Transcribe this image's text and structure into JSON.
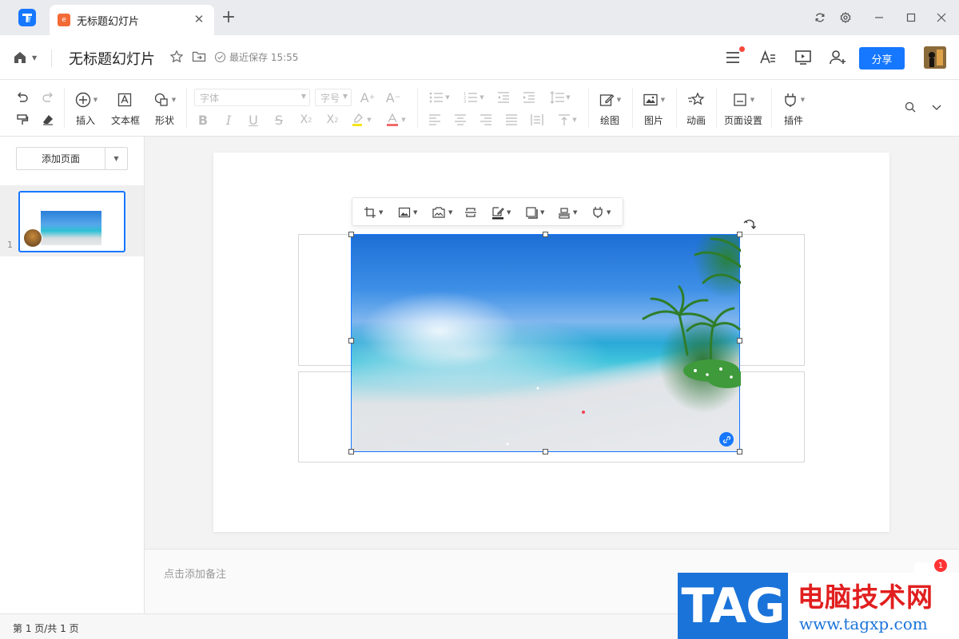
{
  "tab": {
    "title": "无标题幻灯片",
    "favicon": "e"
  },
  "header": {
    "doc_title": "无标题幻灯片",
    "save_status": "最近保存 15:55",
    "share_label": "分享"
  },
  "ribbon": {
    "insert": "插入",
    "textbox": "文本框",
    "shape": "形状",
    "font_placeholder": "字体",
    "size_placeholder": "字号",
    "draw": "绘图",
    "picture": "图片",
    "animation": "动画",
    "page_setup": "页面设置",
    "plugin": "插件"
  },
  "left_panel": {
    "add_page": "添加页面",
    "thumb_number": "1"
  },
  "notes": {
    "placeholder": "点击添加备注"
  },
  "status": {
    "page_count": "第 1 页/共 1 页"
  },
  "notification": {
    "count": "1"
  },
  "watermark": {
    "tag": "TAG",
    "title": "电脑技术网",
    "url": "www.tagxp.com"
  },
  "colors": {
    "accent": "#1677ff",
    "tab_favicon": "#f26a35",
    "badge": "#f5483b",
    "watermark_blue": "#1a73d9",
    "watermark_red": "#e11f1f"
  },
  "icons": [
    "app-logo-icon",
    "close-icon",
    "plus-icon",
    "sync-icon",
    "settings-icon",
    "minimize-icon",
    "maximize-icon",
    "window-close-icon",
    "home-icon",
    "star-icon",
    "move-to-folder-icon",
    "saved-check-icon",
    "menu-icon",
    "text-style-icon",
    "present-icon",
    "add-collaborator-icon",
    "undo-icon",
    "redo-icon",
    "format-painter-icon",
    "eraser-icon",
    "crop-icon",
    "link-icon",
    "rotate-icon",
    "search-icon",
    "collapse-icon"
  ]
}
